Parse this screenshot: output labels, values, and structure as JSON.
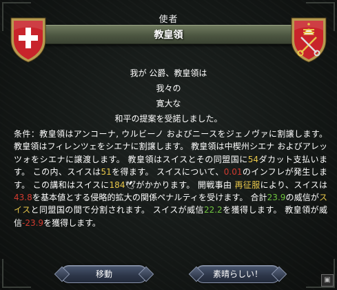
{
  "dialog": {
    "title": "使者",
    "banner": "教皇領"
  },
  "heraldry": {
    "left_shield_colors": {
      "field": "#c8242b",
      "cross": "#ffffff",
      "border": "#b79a4f"
    },
    "right_shield_colors": {
      "field": "#c8242b",
      "emblem": "#e8c74a",
      "border": "#b79a4f"
    },
    "left_icon": "white-cross-shield-icon",
    "right_icon": "papal-keys-shield-icon"
  },
  "message_lines": [
    "我が 公爵、教皇領は",
    "我々の",
    "寛大な",
    "和平の提案を受諾しました。"
  ],
  "terms": [
    {
      "text": "条件：教皇領はアンコーナ, ウルビーノ およびニースをジェノヴァに割譲します。 教皇領はフィレンツェをシエナに割譲します。 教皇領は中楔州シエナ およびアレッツォをシエナに譲渡します。 教皇領はスイスとその同盟国に",
      "style": "plain"
    },
    {
      "text": "54",
      "style": "yellow"
    },
    {
      "text": "ダカット支払います。 この内、スイスは",
      "style": "plain"
    },
    {
      "text": "51",
      "style": "yellow"
    },
    {
      "text": "を得ます。 スイスについて、",
      "style": "plain"
    },
    {
      "text": "0.01",
      "style": "red"
    },
    {
      "text": "のインフレが発生します。 この講和はスイスに",
      "style": "plain"
    },
    {
      "text": "184",
      "style": "yellow"
    },
    {
      "text": "🕊",
      "style": "plain"
    },
    {
      "text": "がかかります。 開戦事由 ",
      "style": "plain"
    },
    {
      "text": "再征服",
      "style": "yellow"
    },
    {
      "text": "により、スイスは",
      "style": "plain"
    },
    {
      "text": "43.8",
      "style": "red"
    },
    {
      "text": "を基本値とする侵略的拡大の関係ペナルティを受けます。 合計",
      "style": "plain"
    },
    {
      "text": "23.9",
      "style": "green"
    },
    {
      "text": "の威信が",
      "style": "plain"
    },
    {
      "text": "スイス",
      "style": "yellow"
    },
    {
      "text": "と同盟国の間で分割されます。 スイスが威信",
      "style": "plain"
    },
    {
      "text": "22.2",
      "style": "green"
    },
    {
      "text": "を獲得します。 教皇領が威信",
      "style": "plain"
    },
    {
      "text": "-23.9",
      "style": "red"
    },
    {
      "text": "を獲得します。",
      "style": "plain"
    }
  ],
  "buttons": {
    "move": "移動",
    "accept": "素晴らしい！"
  }
}
